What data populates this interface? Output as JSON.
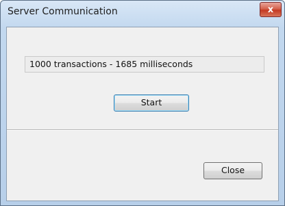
{
  "window": {
    "title": "Server Communication",
    "close_glyph": "x"
  },
  "main": {
    "result_text": "1000 transactions - 1685 milliseconds",
    "start_label": "Start",
    "close_label": "Close"
  },
  "colors": {
    "titlebar": "#c2d8ef",
    "close_button": "#c43a23",
    "client_background": "#f0f0f0"
  }
}
